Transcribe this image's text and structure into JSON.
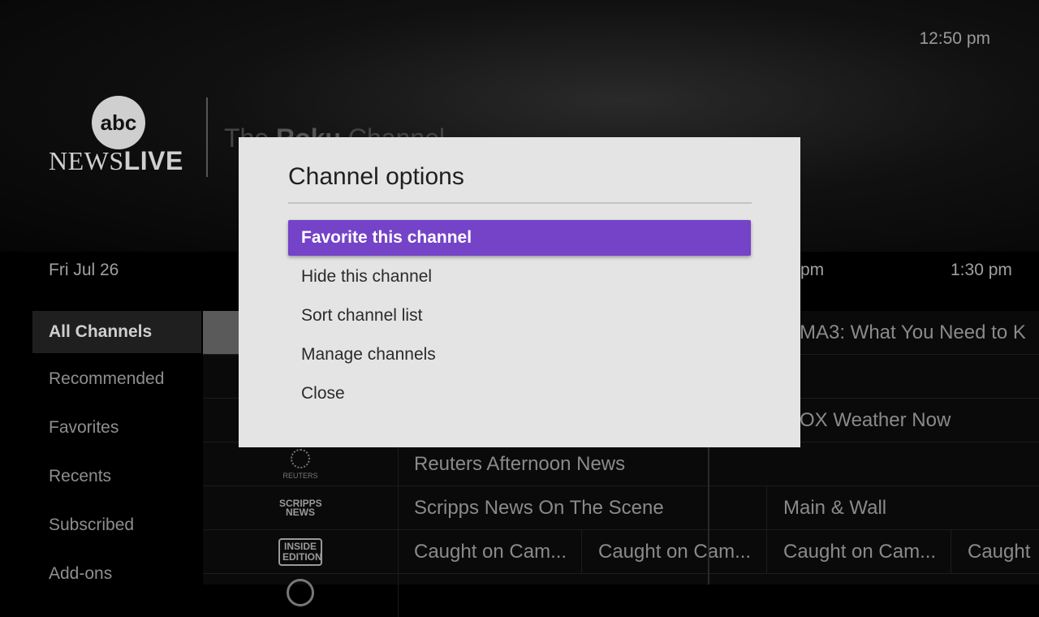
{
  "header": {
    "clock": "12:50 pm",
    "channel_logo": {
      "name": "abc NEWSLIVE",
      "circle_text": "abc",
      "news": "NEWS",
      "live": "LIVE"
    },
    "brand_prefix": "The",
    "brand_name": "Roku",
    "brand_suffix": "Channel"
  },
  "guide": {
    "date": "Fri Jul 26",
    "time_slots": [
      "pm",
      "1:30 pm"
    ],
    "sidebar": [
      {
        "label": "All Channels",
        "active": true
      },
      {
        "label": "Recommended"
      },
      {
        "label": "Favorites"
      },
      {
        "label": "Recents"
      },
      {
        "label": "Subscribed"
      },
      {
        "label": "Add-ons"
      }
    ],
    "rows": [
      {
        "programs": [
          "MA3: What You Need to K"
        ]
      },
      {
        "programs": []
      },
      {
        "programs": [
          "OX Weather Now"
        ]
      },
      {
        "channel_logo": "REUTERS",
        "programs": [
          "Reuters Afternoon News"
        ]
      },
      {
        "channel_logo": "SCRIPPS NEWS",
        "programs": [
          "Scripps News On The Scene",
          "Main & Wall"
        ]
      },
      {
        "channel_logo": "INSIDE EDITION",
        "programs": [
          "Caught on Cam...",
          "Caught on Cam...",
          "Caught on Cam...",
          "Caught"
        ]
      }
    ]
  },
  "modal": {
    "title": "Channel options",
    "options": [
      {
        "label": "Favorite this channel",
        "selected": true
      },
      {
        "label": "Hide this channel"
      },
      {
        "label": "Sort channel list"
      },
      {
        "label": "Manage channels"
      },
      {
        "label": "Close"
      }
    ]
  },
  "colors": {
    "accent": "#7443c8",
    "modal_bg": "#e4e4e4",
    "background": "#000000"
  }
}
